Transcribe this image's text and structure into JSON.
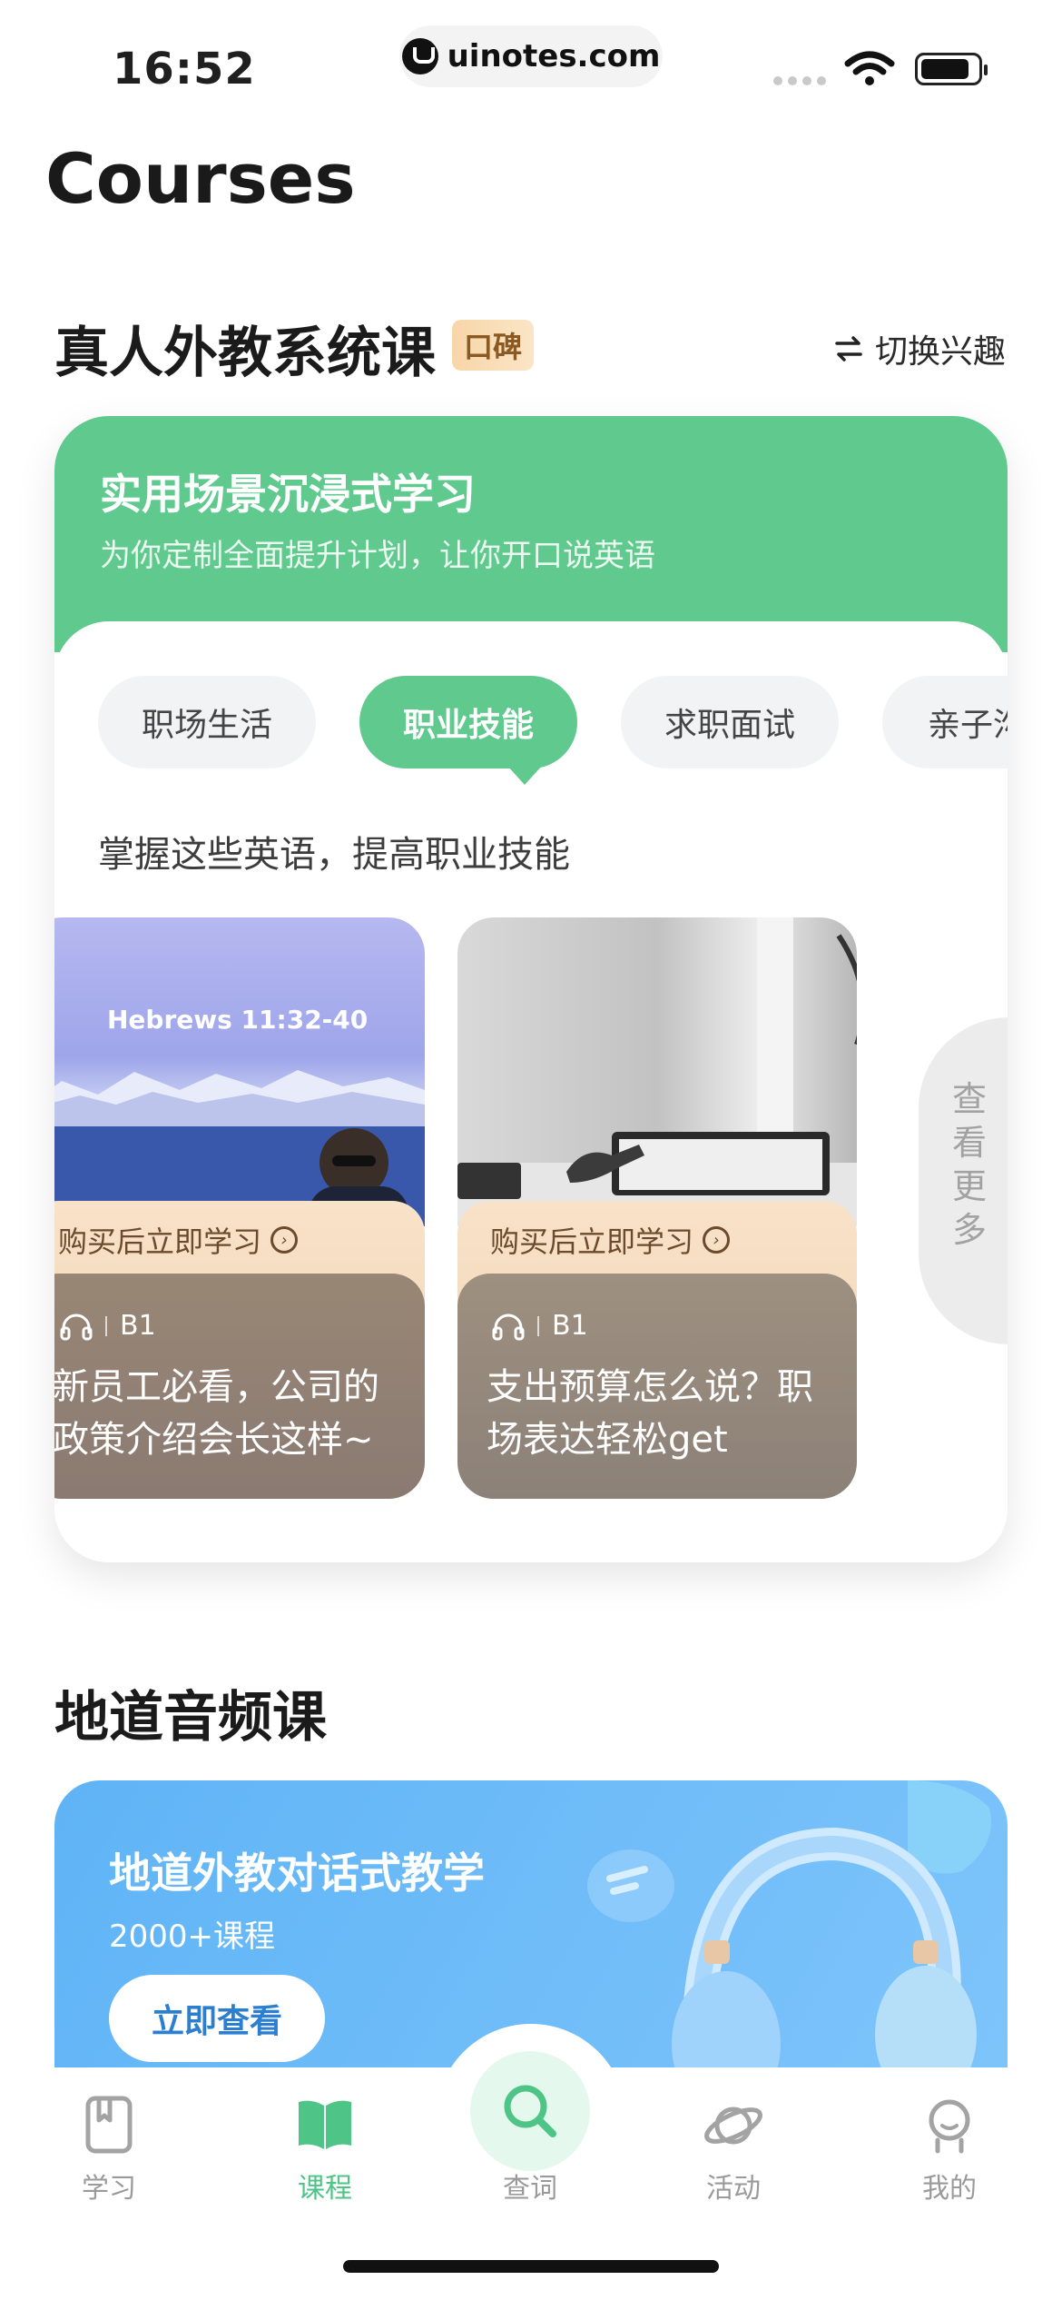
{
  "status_bar": {
    "time": "16:52",
    "url": "uinotes.com"
  },
  "page": {
    "title": "Courses"
  },
  "section_live": {
    "title": "真人外教系统课",
    "badge": "口碑",
    "switch_label": "切换兴趣",
    "card": {
      "headline": "实用场景沉浸式学习",
      "subline": "为你定制全面提升计划，让你开口说英语",
      "chips": [
        "职场生活",
        "职业技能",
        "求职面试",
        "亲子沟"
      ],
      "active_chip": "职业技能",
      "hint": "掌握这些英语，提高职业技能",
      "courses": [
        {
          "buy_label": "购买后立即学习",
          "level": "B1",
          "title": "新员工必看，公司的政策介绍会长这样~",
          "thumb_text": "Hebrews 11:32-40"
        },
        {
          "buy_label": "购买后立即学习",
          "level": "B1",
          "title": "支出预算怎么说？职场表达轻松get"
        }
      ],
      "more_label": "查看更多"
    }
  },
  "section_audio": {
    "title": "地道音频课",
    "banner": {
      "headline": "地道外教对话式教学",
      "count": "2000+课程",
      "cta": "立即查看"
    }
  },
  "tabbar": {
    "items": [
      {
        "label": "学习",
        "icon": "book-icon"
      },
      {
        "label": "课程",
        "icon": "open-book-icon"
      },
      {
        "label": "查词",
        "icon": "search-icon"
      },
      {
        "label": "活动",
        "icon": "planet-icon"
      },
      {
        "label": "我的",
        "icon": "profile-icon"
      }
    ],
    "active": "课程"
  },
  "colors": {
    "accent_green": "#5fc98e",
    "banner_blue": "#64b5f6",
    "tab_active": "#4ec486"
  }
}
